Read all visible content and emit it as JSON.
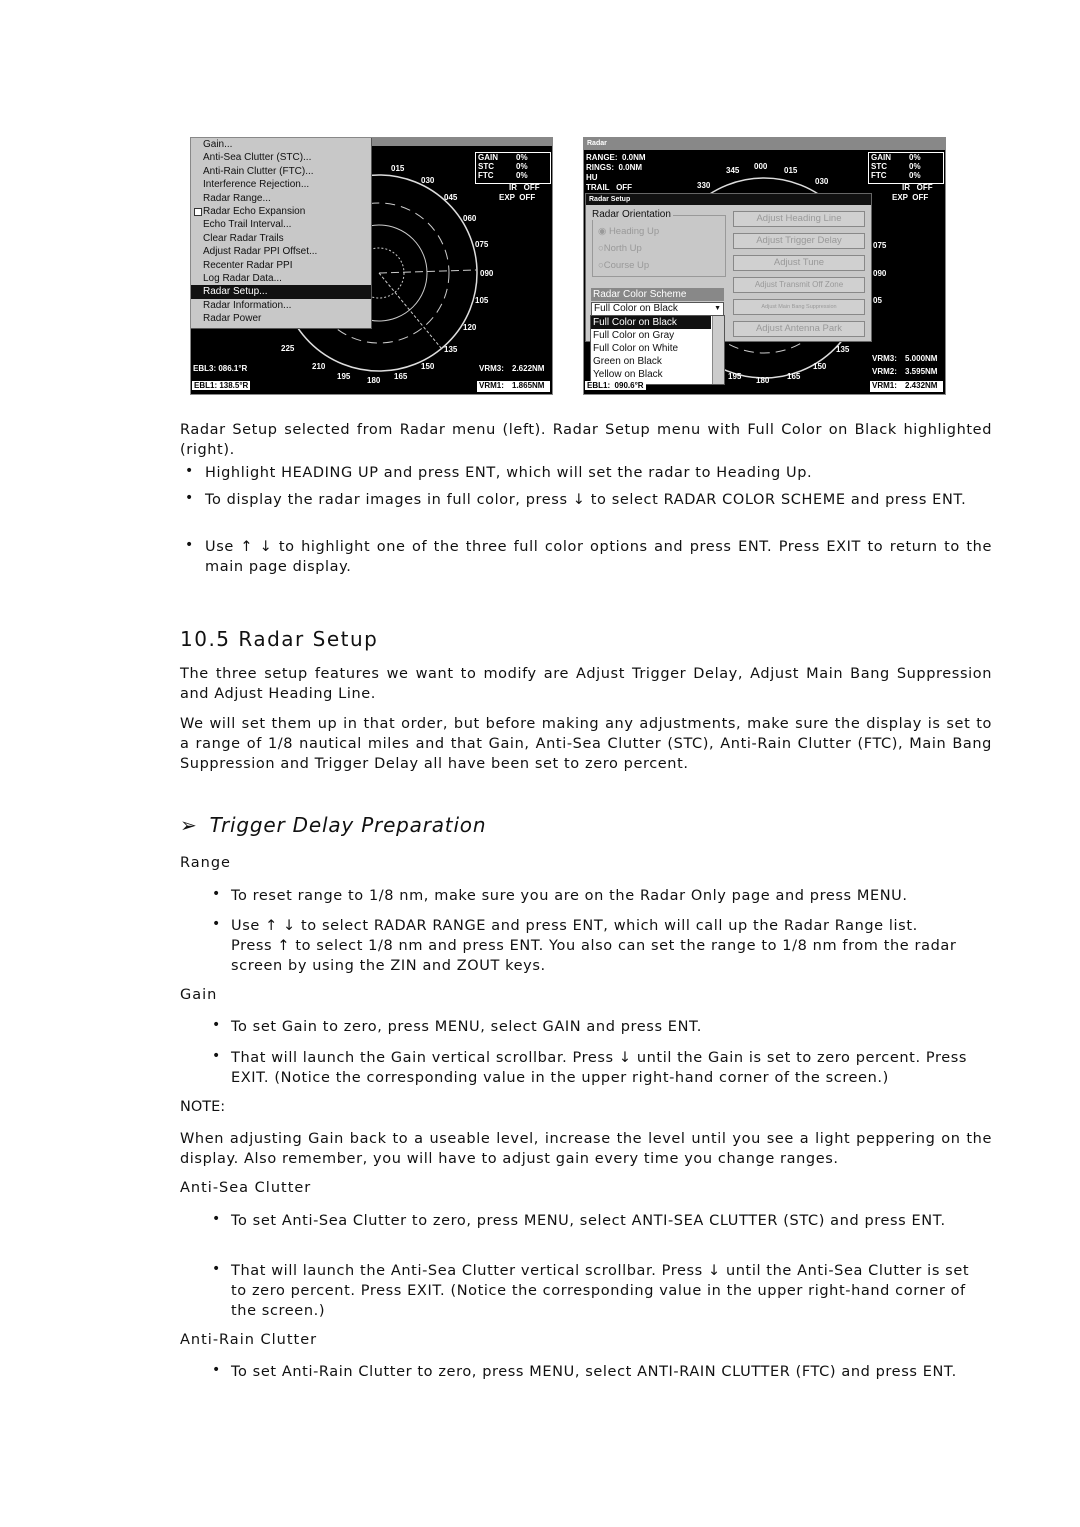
{
  "left_screen": {
    "menu": [
      "Gain...",
      "Anti-Sea Clutter (STC)...",
      "Anti-Rain Clutter (FTC)...",
      "Interference Rejection...",
      "Radar Range...",
      "Radar Echo Expansion",
      "Echo Trail Interval...",
      "Clear Radar Trails",
      "Adjust Radar PPI Offset...",
      "Recenter Radar PPI",
      "Log Radar Data...",
      "Radar Setup...",
      "Radar Information...",
      "Radar Power"
    ],
    "selected": "Radar Setup...",
    "status": {
      "gain_label": "GAIN",
      "gain": "0%",
      "stc_label": "STC",
      "stc": "0%",
      "ftc_label": "FTC",
      "ftc": "0%",
      "ir": "IR   OFF",
      "exp": "EXP  OFF"
    },
    "bearings": [
      "015",
      "030",
      "045",
      "060",
      "075",
      "090",
      "105",
      "120",
      "135",
      "150",
      "165",
      "180",
      "195",
      "210",
      "225"
    ],
    "ebl3": "EBL3:  086.1°R",
    "ebl1": "EBL1:  138.5°R",
    "vrm3_label": "VRM3:",
    "vrm3": "2.622NM",
    "vrm1_label": "VRM1:",
    "vrm1": "1.865NM"
  },
  "right_screen": {
    "title": "Radar",
    "range": "RANGE:  0.0NM",
    "rings": "RINGS:  0.0NM",
    "hu": "HU",
    "trail": "TRAIL   OFF",
    "bearings": [
      "330",
      "345",
      "000",
      "015",
      "030",
      "075",
      "090",
      "05",
      "135",
      "150",
      "165",
      "180",
      "195"
    ],
    "status": {
      "gain_label": "GAIN",
      "gain": "0%",
      "stc_label": "STC",
      "stc": "0%",
      "ftc_label": "FTC",
      "ftc": "0%",
      "ir": "IR   OFF",
      "exp": "EXP  OFF"
    },
    "dialog_title": "Radar Setup",
    "orientation_label": "Radar Orientation",
    "orientations": [
      "Heading Up",
      "North Up",
      "Course Up"
    ],
    "color_scheme_label": "Radar Color Scheme",
    "color_scheme_value": "Full Color on Black",
    "color_options": [
      "Full Color on Black",
      "Full Color on Gray",
      "Full Color on White",
      "Green on Black",
      "Yellow on Black"
    ],
    "buttons": [
      "Adjust Heading Line",
      "Adjust Trigger Delay",
      "Adjust Tune",
      "Adjust Transmit Off Zone",
      "Adjust Main Bang Suppression",
      "Adjust Antenna Park"
    ],
    "ebl1": "EBL1:  090.6°R",
    "vrm3_label": "VRM3:",
    "vrm3": "5.000NM",
    "vrm2_label": "VRM2:",
    "vrm2": "3.595NM",
    "vrm1_label": "VRM1:",
    "vrm1": "2.432NM"
  },
  "caption": "Radar Setup selected from Radar menu (left). Radar Setup menu with Full Color on Black highlighted (right).",
  "bullets1": [
    "Highlight HEADING UP and press ENT, which will set the radar to Heading Up.",
    "To display the radar images in full color, press ↓ to select RADAR COLOR SCHEME and press ENT.",
    "Use ↑ ↓ to highlight one of the three full color options and press ENT. Press EXIT to return to the main page display."
  ],
  "section_title": "10.5 Radar Setup",
  "para1": "The three setup features we want to modify are Adjust Trigger Delay, Adjust Main Bang Suppression and Adjust Heading Line.",
  "para2": "We will set them up in that order, but before making any adjustments, make sure the display is set to a range of 1/8 nautical miles and that Gain, Anti-Sea Clutter (STC), Anti-Rain Clutter (FTC), Main Bang Suppression and Trigger Delay all have been set to zero percent.",
  "subsection_title": "Trigger Delay Preparation",
  "range_label": "Range",
  "range_bullets": [
    "To reset range to 1/8 nm, make sure you are on the Radar Only page and press MENU.",
    "Use ↑ ↓ to select RADAR RANGE and press ENT, which will call up the Radar Range list. Press ↑ to select 1/8 nm and press ENT. You also can set the range to 1/8 nm from the radar screen by using the ZIN and ZOUT keys."
  ],
  "gain_label": "Gain",
  "gain_bullets": [
    "To set Gain to zero, press MENU, select GAIN and press ENT.",
    "That will launch the Gain vertical scrollbar. Press ↓ until the Gain is set to zero percent. Press EXIT. (Notice the corresponding value in the upper right-hand corner of the screen.)"
  ],
  "note_label": "NOTE:",
  "note": "When adjusting Gain back to a useable level, increase the level until you see a light peppering on the display. Also remember, you will have to adjust gain every time you change ranges.",
  "sea_label": "Anti-Sea Clutter",
  "sea_bullets": [
    "To set Anti-Sea Clutter to zero, press MENU, select ANTI-SEA CLUTTER (STC) and press ENT.",
    "That will launch the Anti-Sea Clutter vertical scrollbar. Press ↓ until the Anti-Sea Clutter is set to zero percent. Press EXIT. (Notice the corresponding value in the upper right-hand corner of the screen.)"
  ],
  "rain_label": "Anti-Rain Clutter",
  "rain_bullets": [
    "To set Anti-Rain Clutter to zero, press MENU, select ANTI-RAIN CLUTTER (FTC) and press ENT."
  ]
}
